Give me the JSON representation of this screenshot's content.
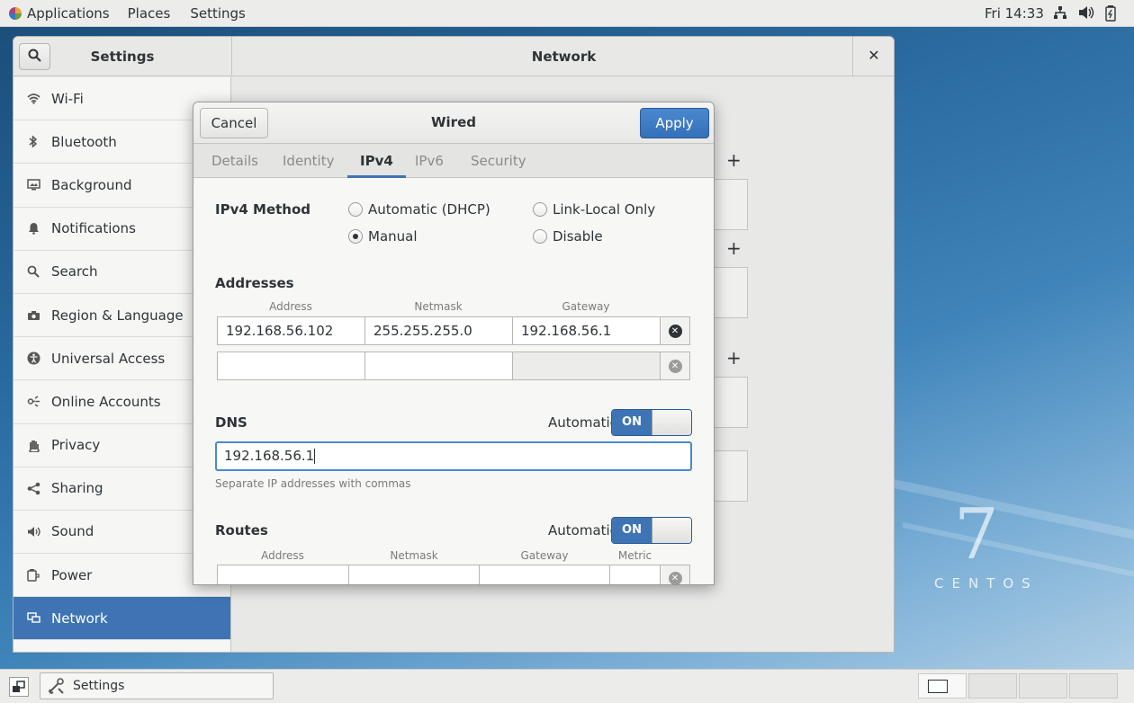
{
  "topbar": {
    "menus": [
      "Applications",
      "Places",
      "Settings"
    ],
    "clock": "Fri 14:33",
    "tray_icons": [
      "network-icon",
      "volume-icon",
      "battery-icon"
    ]
  },
  "desktop": {
    "logo_number": "7",
    "logo_text": "CENTOS"
  },
  "settings_window": {
    "sidebar_title": "Settings",
    "main_title": "Network",
    "sidebar_items": [
      {
        "label": "Wi-Fi",
        "icon": "wifi-icon"
      },
      {
        "label": "Bluetooth",
        "icon": "bluetooth-icon"
      },
      {
        "label": "Background",
        "icon": "background-icon"
      },
      {
        "label": "Notifications",
        "icon": "bell-icon"
      },
      {
        "label": "Search",
        "icon": "search-icon"
      },
      {
        "label": "Region & Language",
        "icon": "camera-icon"
      },
      {
        "label": "Universal Access",
        "icon": "accessibility-icon"
      },
      {
        "label": "Online Accounts",
        "icon": "online-accounts-icon"
      },
      {
        "label": "Privacy",
        "icon": "hand-icon"
      },
      {
        "label": "Sharing",
        "icon": "share-icon"
      },
      {
        "label": "Sound",
        "icon": "speaker-icon"
      },
      {
        "label": "Power",
        "icon": "power-icon"
      },
      {
        "label": "Network",
        "icon": "network-icon",
        "active": true
      }
    ]
  },
  "dialog": {
    "title": "Wired",
    "cancel_label": "Cancel",
    "apply_label": "Apply",
    "tabs": [
      "Details",
      "Identity",
      "IPv4",
      "IPv6",
      "Security"
    ],
    "active_tab": "IPv4",
    "ipv4_method_label": "IPv4 Method",
    "methods": {
      "automatic": "Automatic (DHCP)",
      "link_local": "Link-Local Only",
      "manual": "Manual",
      "disable": "Disable",
      "selected": "Manual"
    },
    "addresses": {
      "title": "Addresses",
      "columns": [
        "Address",
        "Netmask",
        "Gateway"
      ],
      "rows": [
        [
          "192.168.56.102",
          "255.255.255.0",
          "192.168.56.1"
        ],
        [
          "",
          "",
          ""
        ]
      ]
    },
    "dns": {
      "title": "DNS",
      "automatic_label": "Automatic",
      "switch_label": "ON",
      "value": "192.168.56.1",
      "hint": "Separate IP addresses with commas"
    },
    "routes": {
      "title": "Routes",
      "automatic_label": "Automatic",
      "switch_label": "ON",
      "columns": [
        "Address",
        "Netmask",
        "Gateway",
        "Metric"
      ]
    }
  },
  "taskbar": {
    "task_label": "Settings",
    "workspaces": 4
  },
  "colors": {
    "accent": "#3f74b4",
    "apply_button": "#3570b8",
    "panel": "#ececea"
  }
}
